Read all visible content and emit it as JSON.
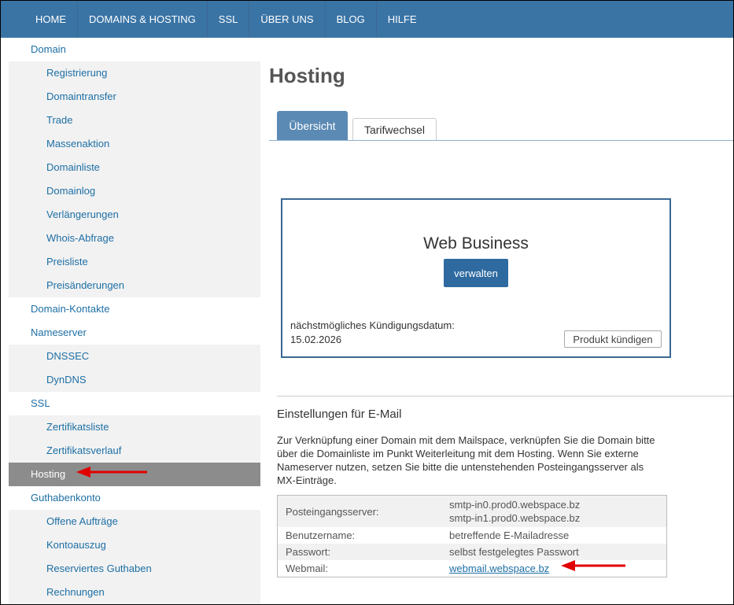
{
  "nav": {
    "items": [
      "HOME",
      "DOMAINS & HOSTING",
      "SSL",
      "ÜBER UNS",
      "BLOG",
      "HILFE"
    ]
  },
  "sidebar": {
    "items": [
      {
        "label": "Domain",
        "level": "top"
      },
      {
        "label": "Registrierung",
        "level": "sub"
      },
      {
        "label": "Domaintransfer",
        "level": "sub"
      },
      {
        "label": "Trade",
        "level": "sub"
      },
      {
        "label": "Massenaktion",
        "level": "sub"
      },
      {
        "label": "Domainliste",
        "level": "sub"
      },
      {
        "label": "Domainlog",
        "level": "sub"
      },
      {
        "label": "Verlängerungen",
        "level": "sub"
      },
      {
        "label": "Whois-Abfrage",
        "level": "sub"
      },
      {
        "label": "Preisliste",
        "level": "sub"
      },
      {
        "label": "Preisänderungen",
        "level": "sub"
      },
      {
        "label": "Domain-Kontakte",
        "level": "top"
      },
      {
        "label": "Nameserver",
        "level": "top"
      },
      {
        "label": "DNSSEC",
        "level": "sub"
      },
      {
        "label": "DynDNS",
        "level": "sub"
      },
      {
        "label": "SSL",
        "level": "top"
      },
      {
        "label": "Zertifikatsliste",
        "level": "sub"
      },
      {
        "label": "Zertifikatsverlauf",
        "level": "sub"
      },
      {
        "label": "Hosting",
        "level": "top",
        "active": true
      },
      {
        "label": "Guthabenkonto",
        "level": "top"
      },
      {
        "label": "Offene Aufträge",
        "level": "sub"
      },
      {
        "label": "Kontoauszug",
        "level": "sub"
      },
      {
        "label": "Reserviertes Guthaben",
        "level": "sub"
      },
      {
        "label": "Rechnungen",
        "level": "sub"
      }
    ]
  },
  "main": {
    "title": "Hosting",
    "tabs": [
      {
        "label": "Übersicht",
        "active": true
      },
      {
        "label": "Tarifwechsel",
        "active": false
      }
    ],
    "product": {
      "name": "Web Business",
      "manage_label": "verwalten",
      "cancel_info_label": "nächstmögliches Kündigungsdatum:",
      "cancel_date": "15.02.2026",
      "cancel_button": "Produkt kündigen"
    },
    "email": {
      "heading": "Einstellungen für E-Mail",
      "description": "Zur Verknüpfung einer Domain mit dem Mailspace, verknüpfen Sie die Domain bitte über die Domainliste im Punkt Weiterleitung mit dem Hosting. Wenn Sie externe Nameserver nutzen, setzen Sie bitte die untenstehenden Posteingangsserver als MX-Einträge.",
      "rows": {
        "incoming_label": "Posteingangsserver:",
        "incoming_1": "smtp-in0.prod0.webspace.bz",
        "incoming_2": "smtp-in1.prod0.webspace.bz",
        "username_label": "Benutzername:",
        "username_value": "betreffende E-Mailadresse",
        "password_label": "Passwort:",
        "password_value": "selbst festgelegtes Passwort",
        "webmail_label": "Webmail:",
        "webmail_link": "webmail.webspace.bz"
      }
    }
  },
  "colors": {
    "nav_bg": "#3a74a5",
    "link": "#1d6fa5",
    "active_sidebar": "#8c8c8c",
    "annotation_arrow": "#e00000"
  }
}
